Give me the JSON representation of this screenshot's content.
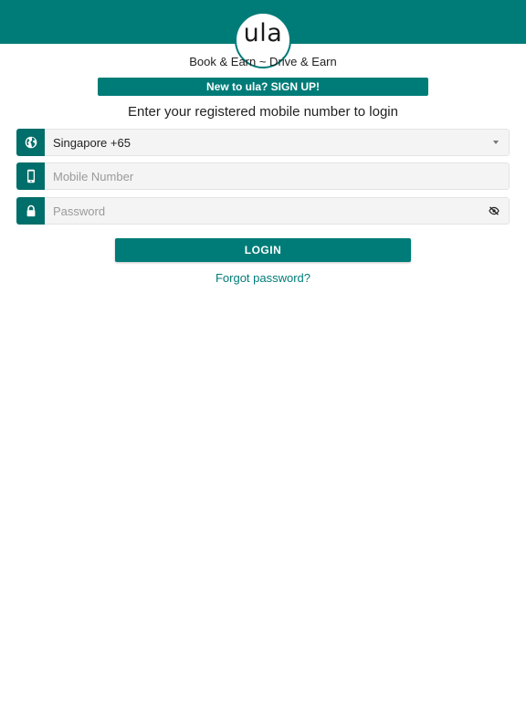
{
  "brand": {
    "logo_text": "ula",
    "primary_color": "#007c78",
    "tagline": "Book & Earn ~ Drive & Earn"
  },
  "signup": {
    "label": "New to ula? SIGN UP!"
  },
  "instruction": "Enter your registered mobile number to login",
  "form": {
    "country": {
      "icon": "globe-icon",
      "selected": "Singapore +65"
    },
    "mobile": {
      "icon": "phone-icon",
      "value": "",
      "placeholder": "Mobile Number"
    },
    "password": {
      "icon": "lock-icon",
      "value": "",
      "placeholder": "Password",
      "toggle_icon": "eye-off-icon"
    }
  },
  "login": {
    "label": "LOGIN"
  },
  "forgot": {
    "label": "Forgot password?"
  }
}
